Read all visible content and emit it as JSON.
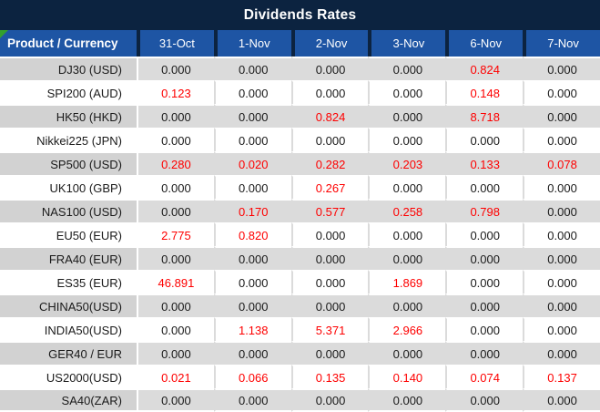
{
  "chart_data": {
    "type": "table",
    "title": "Dividends Rates",
    "columns": [
      "Product / Currency",
      "31-Oct",
      "1-Nov",
      "2-Nov",
      "3-Nov",
      "6-Nov",
      "7-Nov"
    ],
    "rows": [
      {
        "product": "DJ30 (USD)",
        "values": [
          "0.000",
          "0.000",
          "0.000",
          "0.000",
          "0.824",
          "0.000"
        ],
        "red": [
          0,
          0,
          0,
          0,
          1,
          0
        ]
      },
      {
        "product": "SPI200 (AUD)",
        "values": [
          "0.123",
          "0.000",
          "0.000",
          "0.000",
          "0.148",
          "0.000"
        ],
        "red": [
          1,
          0,
          0,
          0,
          1,
          0
        ]
      },
      {
        "product": "HK50 (HKD)",
        "values": [
          "0.000",
          "0.000",
          "0.824",
          "0.000",
          "8.718",
          "0.000"
        ],
        "red": [
          0,
          0,
          1,
          0,
          1,
          0
        ]
      },
      {
        "product": "Nikkei225 (JPN)",
        "values": [
          "0.000",
          "0.000",
          "0.000",
          "0.000",
          "0.000",
          "0.000"
        ],
        "red": [
          0,
          0,
          0,
          0,
          0,
          0
        ]
      },
      {
        "product": "SP500 (USD)",
        "values": [
          "0.280",
          "0.020",
          "0.282",
          "0.203",
          "0.133",
          "0.078"
        ],
        "red": [
          1,
          1,
          1,
          1,
          1,
          1
        ]
      },
      {
        "product": "UK100 (GBP)",
        "values": [
          "0.000",
          "0.000",
          "0.267",
          "0.000",
          "0.000",
          "0.000"
        ],
        "red": [
          0,
          0,
          1,
          0,
          0,
          0
        ]
      },
      {
        "product": "NAS100 (USD)",
        "values": [
          "0.000",
          "0.170",
          "0.577",
          "0.258",
          "0.798",
          "0.000"
        ],
        "red": [
          0,
          1,
          1,
          1,
          1,
          0
        ]
      },
      {
        "product": "EU50 (EUR)",
        "values": [
          "2.775",
          "0.820",
          "0.000",
          "0.000",
          "0.000",
          "0.000"
        ],
        "red": [
          1,
          1,
          0,
          0,
          0,
          0
        ]
      },
      {
        "product": "FRA40 (EUR)",
        "values": [
          "0.000",
          "0.000",
          "0.000",
          "0.000",
          "0.000",
          "0.000"
        ],
        "red": [
          0,
          0,
          0,
          0,
          0,
          0
        ]
      },
      {
        "product": "ES35 (EUR)",
        "values": [
          "46.891",
          "0.000",
          "0.000",
          "1.869",
          "0.000",
          "0.000"
        ],
        "red": [
          1,
          0,
          0,
          1,
          0,
          0
        ]
      },
      {
        "product": "CHINA50(USD)",
        "values": [
          "0.000",
          "0.000",
          "0.000",
          "0.000",
          "0.000",
          "0.000"
        ],
        "red": [
          0,
          0,
          0,
          0,
          0,
          0
        ]
      },
      {
        "product": "INDIA50(USD)",
        "values": [
          "0.000",
          "1.138",
          "5.371",
          "2.966",
          "0.000",
          "0.000"
        ],
        "red": [
          0,
          1,
          1,
          1,
          0,
          0
        ]
      },
      {
        "product": "GER40 / EUR",
        "values": [
          "0.000",
          "0.000",
          "0.000",
          "0.000",
          "0.000",
          "0.000"
        ],
        "red": [
          0,
          0,
          0,
          0,
          0,
          0
        ]
      },
      {
        "product": "US2000(USD)",
        "values": [
          "0.021",
          "0.066",
          "0.135",
          "0.140",
          "0.074",
          "0.137"
        ],
        "red": [
          1,
          1,
          1,
          1,
          1,
          1
        ]
      },
      {
        "product": "SA40(ZAR)",
        "values": [
          "0.000",
          "0.000",
          "0.000",
          "0.000",
          "0.000",
          "0.000"
        ],
        "red": [
          0,
          0,
          0,
          0,
          0,
          0
        ]
      }
    ]
  },
  "colors": {
    "navy": "#0C2340",
    "blue": "#1E55A4",
    "red": "#FE0000",
    "green": "#33A02C",
    "rowgray": "#DBDBDB",
    "prodgray": "#D2D2D2"
  }
}
